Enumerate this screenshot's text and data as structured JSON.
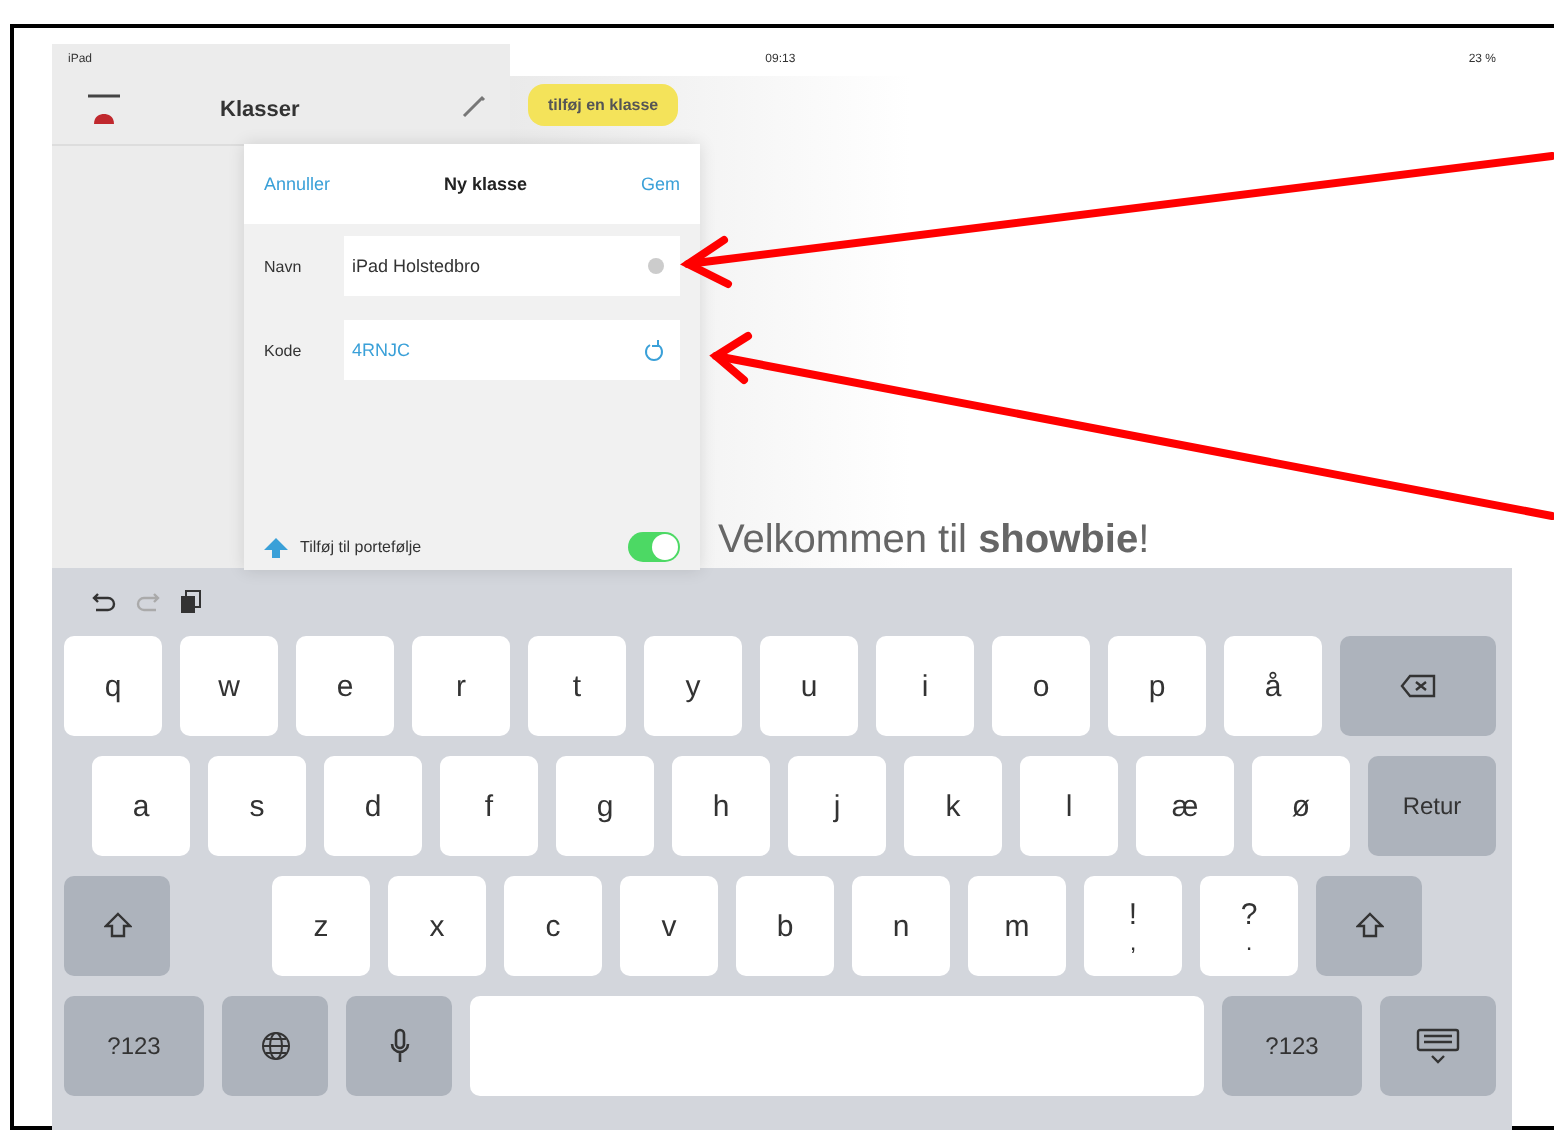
{
  "status_bar": {
    "carrier": "iPad",
    "time": "09:13",
    "battery": "23 %"
  },
  "sidebar": {
    "title": "Klasser"
  },
  "add_class_tip": "tilføj en klasse",
  "dialog": {
    "cancel": "Annuller",
    "title": "Ny klasse",
    "save": "Gem",
    "fields": [
      {
        "label": "Navn",
        "value": "iPad Holstedbro",
        "kind": "text"
      },
      {
        "label": "Kode",
        "value": "4RNJC",
        "kind": "code"
      }
    ],
    "portfolio": {
      "label": "Tilføj til portefølje",
      "on": true
    }
  },
  "welcome": "Velkommen til **showbie**!",
  "keyboard": {
    "rows": [
      {
        "keys": [
          {
            "kind": "char",
            "label": "q"
          },
          {
            "kind": "char",
            "label": "w"
          },
          {
            "kind": "char",
            "label": "e"
          },
          {
            "kind": "char",
            "label": "r"
          },
          {
            "kind": "char",
            "label": "t"
          },
          {
            "kind": "char",
            "label": "y"
          },
          {
            "kind": "char",
            "label": "u"
          },
          {
            "kind": "char",
            "label": "i"
          },
          {
            "kind": "char",
            "label": "o"
          },
          {
            "kind": "char",
            "label": "p"
          },
          {
            "kind": "char",
            "label": "å"
          },
          {
            "kind": "backspace"
          }
        ]
      },
      {
        "keys": [
          {
            "kind": "char",
            "label": "a"
          },
          {
            "kind": "char",
            "label": "s"
          },
          {
            "kind": "char",
            "label": "d"
          },
          {
            "kind": "char",
            "label": "f"
          },
          {
            "kind": "char",
            "label": "g"
          },
          {
            "kind": "char",
            "label": "h"
          },
          {
            "kind": "char",
            "label": "j"
          },
          {
            "kind": "char",
            "label": "k"
          },
          {
            "kind": "char",
            "label": "l"
          },
          {
            "kind": "char",
            "label": "æ"
          },
          {
            "kind": "char",
            "label": "ø"
          },
          {
            "kind": "return",
            "label": "Retur"
          }
        ]
      },
      {
        "keys": [
          {
            "kind": "shift"
          },
          {
            "kind": "char",
            "label": "z"
          },
          {
            "kind": "char",
            "label": "x"
          },
          {
            "kind": "char",
            "label": "c"
          },
          {
            "kind": "char",
            "label": "v"
          },
          {
            "kind": "char",
            "label": "b"
          },
          {
            "kind": "char",
            "label": "n"
          },
          {
            "kind": "char",
            "label": "m"
          },
          {
            "kind": "punct",
            "label": "!",
            "sub": ","
          },
          {
            "kind": "punct",
            "label": "?",
            "sub": "."
          },
          {
            "kind": "shift"
          }
        ]
      },
      {
        "keys": [
          {
            "kind": "numbers",
            "label": "?123"
          },
          {
            "kind": "globe"
          },
          {
            "kind": "mic"
          },
          {
            "kind": "space"
          },
          {
            "kind": "numbers",
            "label": "?123"
          },
          {
            "kind": "hide"
          }
        ]
      }
    ]
  }
}
